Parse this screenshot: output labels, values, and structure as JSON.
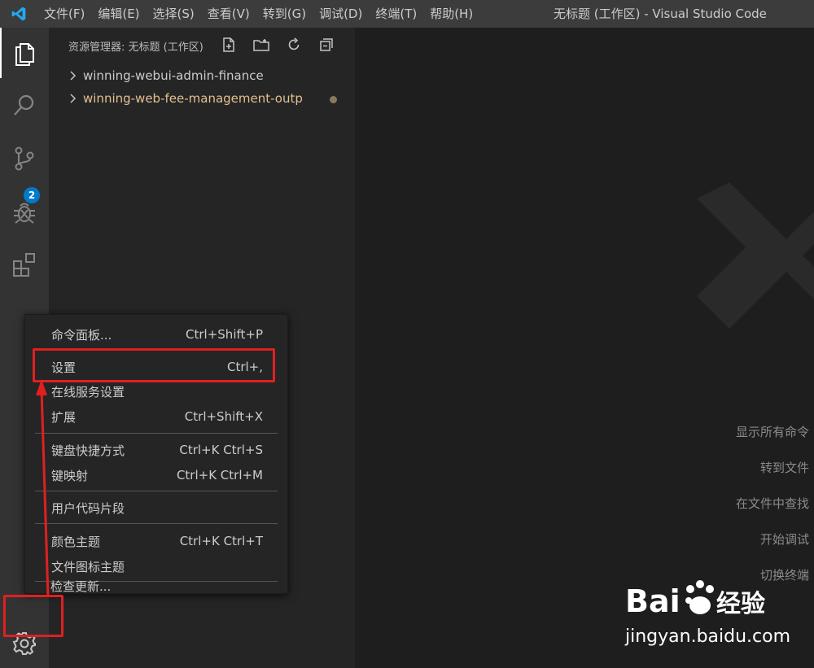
{
  "menubar": {
    "items": [
      "文件(F)",
      "编辑(E)",
      "选择(S)",
      "查看(V)",
      "转到(G)",
      "调试(D)",
      "终端(T)",
      "帮助(H)"
    ]
  },
  "window": {
    "title": "无标题 (工作区) - Visual Studio Code"
  },
  "activitybar": {
    "icons": [
      "explorer-icon",
      "search-icon",
      "source-control-icon",
      "debug-icon",
      "extensions-icon",
      "gear-icon"
    ],
    "scm_badge": "2"
  },
  "sidebar": {
    "header": "资源管理器: 无标题 (工作区)",
    "tree": [
      {
        "label": "winning-webui-admin-finance",
        "modified": false
      },
      {
        "label": "winning-web-fee-management-outp",
        "modified": true
      }
    ]
  },
  "editor": {
    "shortcuts": [
      "显示所有命令",
      "转到文件",
      "在文件中查找",
      "开始调试",
      "切换终端"
    ]
  },
  "context_menu": {
    "items": [
      {
        "label": "命令面板...",
        "shortcut": "Ctrl+Shift+P"
      },
      {
        "label": "设置",
        "shortcut": "Ctrl+,"
      },
      {
        "label": "在线服务设置",
        "shortcut": ""
      },
      {
        "label": "扩展",
        "shortcut": "Ctrl+Shift+X"
      },
      {
        "label": "键盘快捷方式",
        "shortcut": "Ctrl+K Ctrl+S"
      },
      {
        "label": "键映射",
        "shortcut": "Ctrl+K Ctrl+M"
      },
      {
        "label": "用户代码片段",
        "shortcut": ""
      },
      {
        "label": "颜色主题",
        "shortcut": "Ctrl+K Ctrl+T"
      },
      {
        "label": "文件图标主题",
        "shortcut": ""
      },
      {
        "label": "检查更新...",
        "shortcut": ""
      }
    ]
  },
  "watermark": {
    "brand": "Bai 经验",
    "url": "jingyan.baidu.com"
  },
  "colors": {
    "accent": "#007acc",
    "annotation": "#e02020",
    "modified": "#e2c08d"
  }
}
